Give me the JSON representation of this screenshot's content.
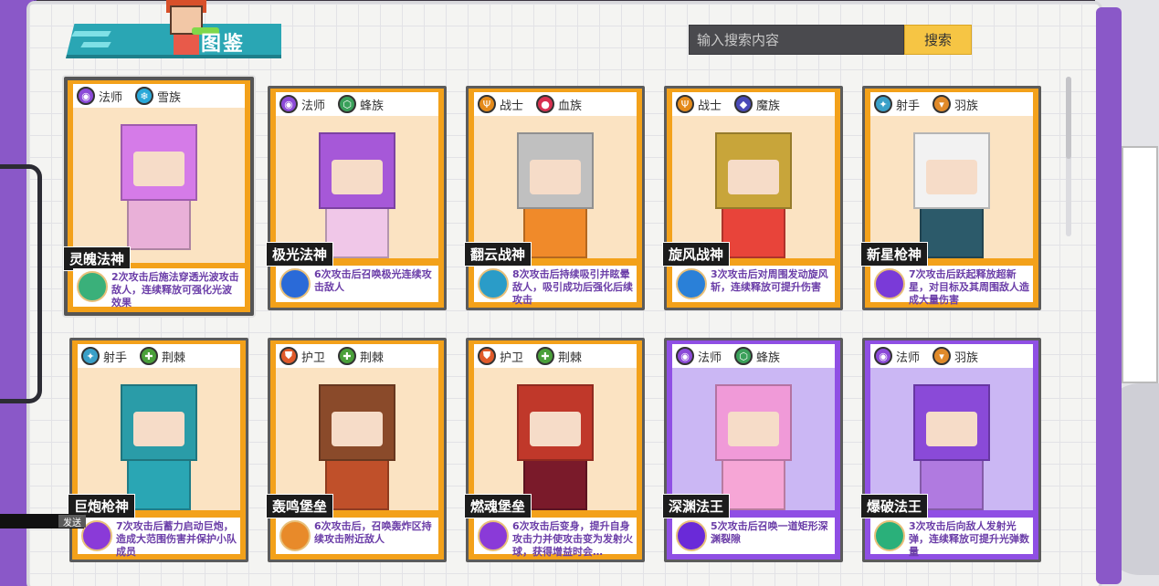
{
  "header": {
    "title": "图鉴"
  },
  "search": {
    "placeholder": "输入搜索内容",
    "button_label": "搜索"
  },
  "chat": {
    "send_label": "发送"
  },
  "cards": [
    {
      "role": "法师",
      "race": "雪族",
      "name": "灵魄法神",
      "desc": "2次攻击后施法穿透光波攻击敌人，连续释放可强化光波效果",
      "theme": "orange",
      "selected": true
    },
    {
      "role": "法师",
      "race": "蜂族",
      "name": "极光法神",
      "desc": "6次攻击后召唤极光连续攻击敌人",
      "theme": "orange"
    },
    {
      "role": "战士",
      "race": "血族",
      "name": "翻云战神",
      "desc": "8次攻击后持续吸引并眩晕敌人，吸引成功后强化后续攻击",
      "theme": "orange"
    },
    {
      "role": "战士",
      "race": "魔族",
      "name": "旋风战神",
      "desc": "3次攻击后对周围发动旋风斩，连续释放可提升伤害",
      "theme": "orange"
    },
    {
      "role": "射手",
      "race": "羽族",
      "name": "新星枪神",
      "desc": "7次攻击后跃起释放超新星，对目标及其周围敌人造成大量伤害",
      "theme": "orange"
    },
    {
      "role": "射手",
      "race": "荆棘",
      "name": "巨炮枪神",
      "desc": "7次攻击后蓄力启动巨炮，造成大范围伤害并保护小队成员",
      "theme": "orange"
    },
    {
      "role": "护卫",
      "race": "荆棘",
      "name": "轰鸣堡垒",
      "desc": "6次攻击后，召唤轰炸区持续攻击附近敌人",
      "theme": "orange"
    },
    {
      "role": "护卫",
      "race": "荆棘",
      "name": "燃魂堡垒",
      "desc": "6次攻击后变身，提升自身攻击力并使攻击变为发射火球，获得增益时会…",
      "theme": "orange"
    },
    {
      "role": "法师",
      "race": "蜂族",
      "name": "深渊法王",
      "desc": "5次攻击后召唤一道矩形深渊裂隙",
      "theme": "purple"
    },
    {
      "role": "法师",
      "race": "羽族",
      "name": "爆破法王",
      "desc": "3次攻击后向敌人发射光弹，连续释放可提升光弹数量",
      "theme": "purple"
    }
  ],
  "icons": {
    "mage": "mage-role-icon",
    "warrior": "warrior-role-icon",
    "shooter": "shooter-role-icon",
    "guard": "guard-role-icon"
  }
}
